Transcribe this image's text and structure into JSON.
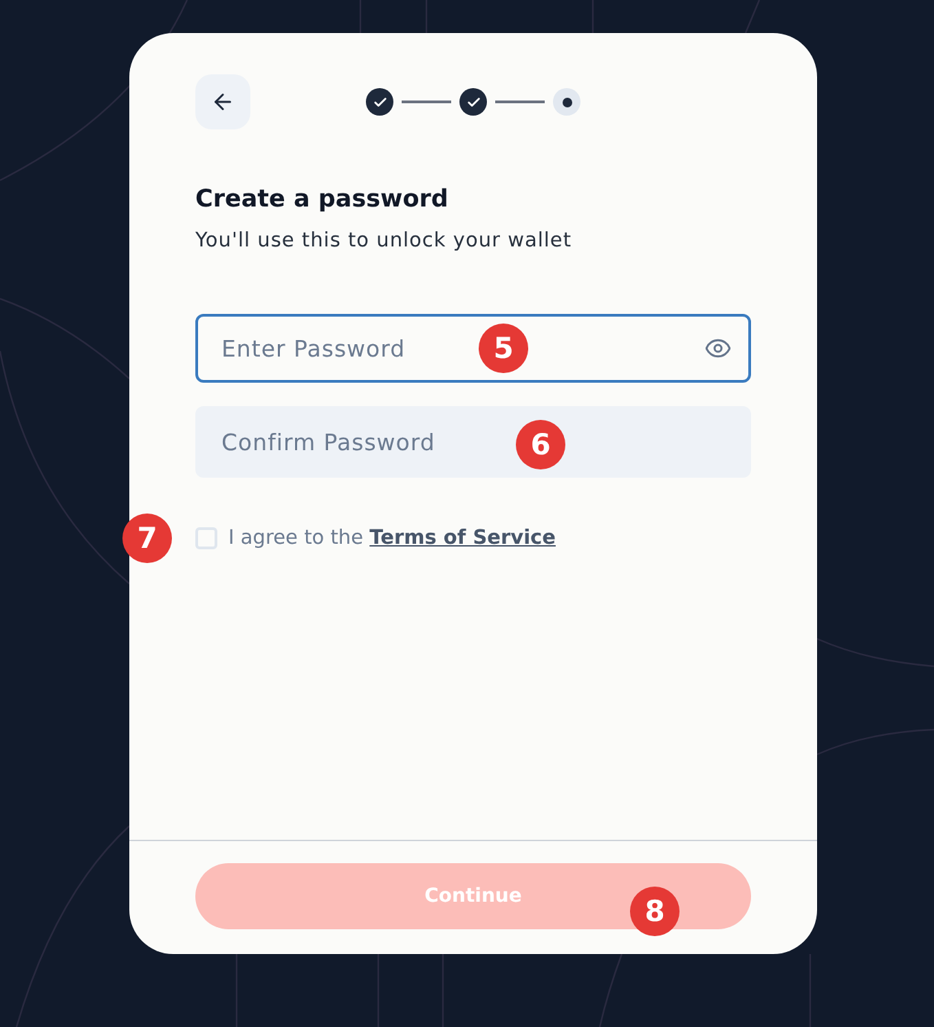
{
  "stepper": {
    "steps": [
      {
        "completed": true
      },
      {
        "completed": true
      },
      {
        "completed": false
      }
    ]
  },
  "heading": "Create a password",
  "subtitle": "You'll use this to unlock your wallet",
  "fields": [
    {
      "kind": "password",
      "placeholder": "Enter Password",
      "focused": true,
      "marker": "5"
    },
    {
      "kind": "confirm",
      "placeholder": "Confirm Password",
      "focused": false,
      "marker": "6"
    }
  ],
  "agreement": {
    "checked": false,
    "text": "I agree to the",
    "link": "Terms of Service",
    "marker": "7"
  },
  "continue_button": {
    "label": "Continue",
    "disabled": true,
    "marker": "8"
  }
}
